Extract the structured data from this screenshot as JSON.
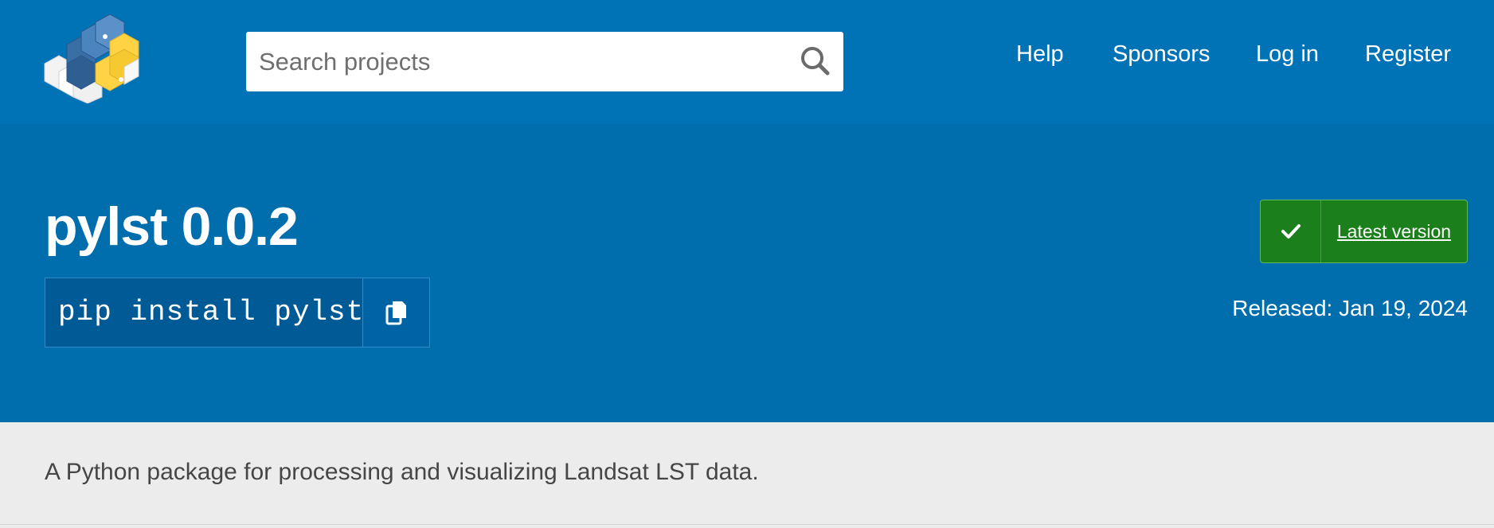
{
  "header": {
    "logo_alt": "PyPI",
    "search": {
      "placeholder": "Search projects",
      "value": "",
      "button_icon": "search-icon"
    },
    "nav": [
      {
        "label": "Help"
      },
      {
        "label": "Sponsors"
      },
      {
        "label": "Log in"
      },
      {
        "label": "Register"
      }
    ]
  },
  "package": {
    "title": "pylst 0.0.2",
    "install_command": "pip install pylst",
    "copy_icon": "copy-icon",
    "latest_version_label": "Latest version",
    "latest_icon": "check-icon",
    "released": "Released: Jan 19, 2024",
    "summary": "A Python package for processing and visualizing Landsat LST data."
  },
  "colors": {
    "header_bg": "#0073b7",
    "banner_bg": "#006dad",
    "latest_green": "#1b801b",
    "description_bg": "#ececec"
  }
}
